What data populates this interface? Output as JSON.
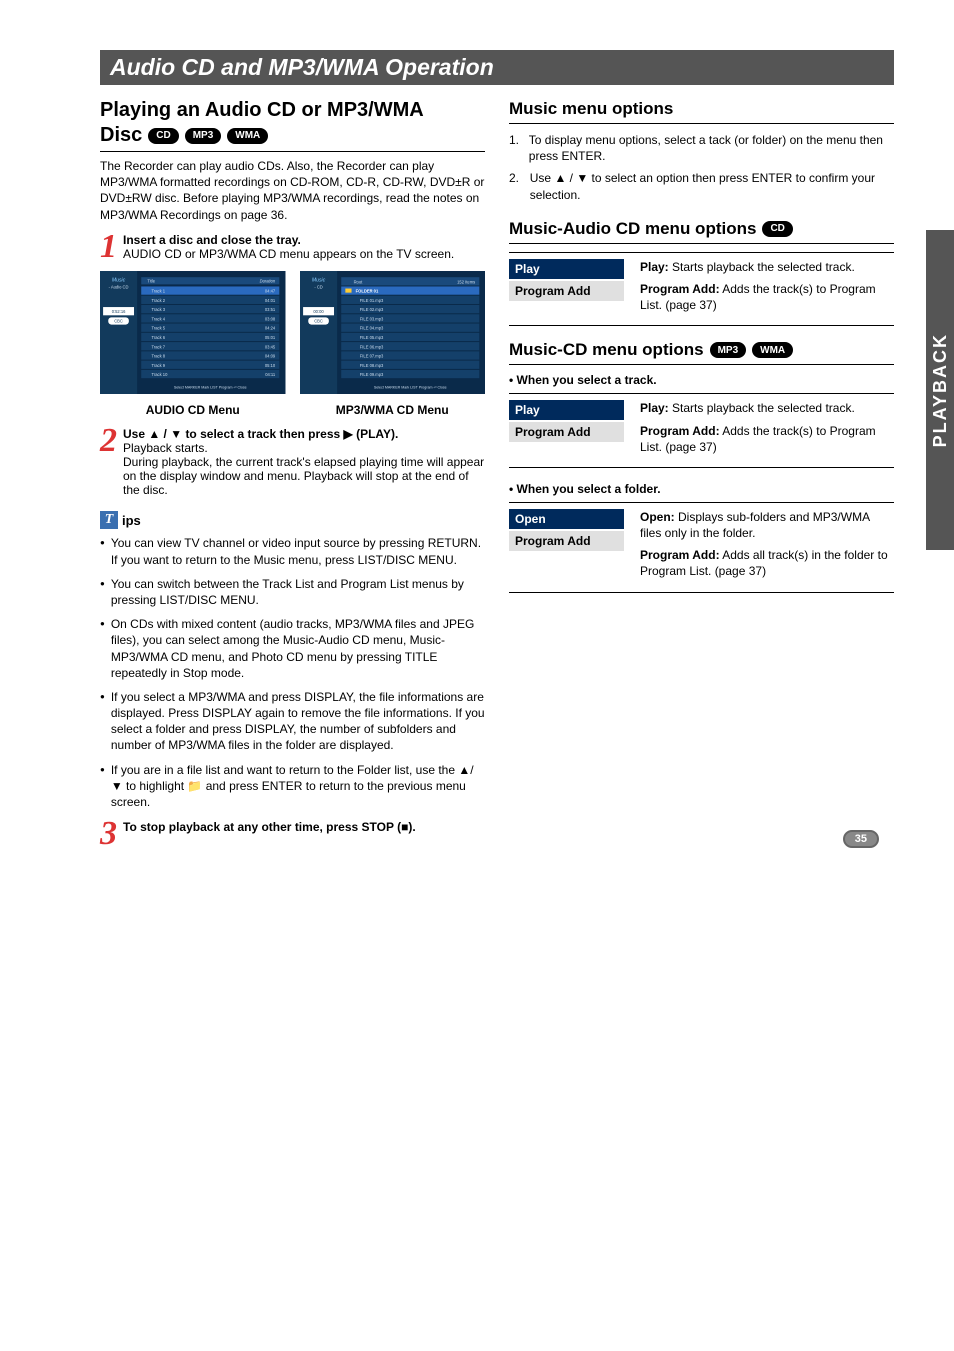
{
  "sidebar_tab": "PLAYBACK",
  "section_header": "Audio CD and MP3/WMA Operation",
  "left": {
    "title": "Playing an Audio CD or MP3/WMA",
    "disc_label": "Disc",
    "pills": [
      "CD",
      "MP3",
      "WMA"
    ],
    "intro": "The Recorder can play audio CDs. Also, the Recorder can play MP3/WMA formatted recordings on CD-ROM, CD-R, CD-RW, DVD±R or DVD±RW disc. Before playing MP3/WMA recordings, read the notes on MP3/WMA Recordings on page 36.",
    "step1_num": "1",
    "step1_bold": "Insert a disc and close the tray.",
    "step1_rest": "AUDIO CD or MP3/WMA CD menu appears on the TV screen.",
    "step2_num": "2",
    "step2_bold": "Use ▲ / ▼ to select a track then press ▶ (PLAY).",
    "step2_p1": "Playback starts.",
    "step2_p2": "During playback, the current track's elapsed playing time will appear on the display window and menu. Playback will stop at the end of the disc.",
    "step3_num": "3",
    "step3_bold": "To stop playback at any other time, press STOP (■).",
    "tips_label": "ips",
    "tips": [
      "You can view TV channel or video input source by pressing RETURN. If you want to return to the Music menu, press LIST/DISC MENU.",
      "You can switch between the Track List and Program List menus by pressing LIST/DISC MENU.",
      "On CDs with mixed content (audio tracks, MP3/WMA files and JPEG files), you can select among the Music-Audio CD menu, Music-MP3/WMA CD menu, and Photo CD menu by pressing TITLE repeatedly in Stop mode.",
      "If you select a MP3/WMA and press DISPLAY, the file informations are displayed. Press DISPLAY again to remove the file informations. If you select a folder and press DISPLAY, the number of subfolders and number of MP3/WMA files in the folder are displayed.",
      "If you are in a file list and want to return to the Folder list, use the ▲/▼ to highlight 📁 and press ENTER to return to the previous menu screen."
    ],
    "shot1": {
      "caption": "AUDIO CD Menu",
      "sidebar_title": "Music",
      "sidebar_sub": "- Audio CD",
      "status_time": "0:52:16",
      "status_badge": "CBC",
      "col_title": "Title",
      "col_duration": "Duration",
      "rows": [
        {
          "t": "Track 1",
          "d": "04:47"
        },
        {
          "t": "Track 2",
          "d": "04:01"
        },
        {
          "t": "Track 3",
          "d": "03:51"
        },
        {
          "t": "Track 4",
          "d": "03:08"
        },
        {
          "t": "Track 5",
          "d": "04:24"
        },
        {
          "t": "Track 6",
          "d": "05:01"
        },
        {
          "t": "Track 7",
          "d": "03:45"
        },
        {
          "t": "Track 8",
          "d": "04:09"
        },
        {
          "t": "Track 9",
          "d": "05:10"
        },
        {
          "t": "Track 10",
          "d": "04:11"
        }
      ],
      "footer": "Select  MARKER Mark  LIST Program  ⏎ Close"
    },
    "shot2": {
      "caption": "MP3/WMA CD Menu",
      "sidebar_title": "Music",
      "sidebar_sub": "- CD",
      "status_time": "00:00",
      "status_badge": "CBC",
      "root": "Root",
      "items_count": "152 Items",
      "folder": "FOLDER 01",
      "files": [
        "FILE 01.mp3",
        "FILE 02.mp3",
        "FILE 03.mp3",
        "FILE 04.mp3",
        "FILE 05.mp3",
        "FILE 06.mp3",
        "FILE 07.mp3",
        "FILE 08.mp3",
        "FILE 09.mp3"
      ],
      "footer": "Select  MARKER Mark  LIST Program  ⏎ Close"
    }
  },
  "right": {
    "h1": "Music menu options",
    "list": [
      "To display menu options, select a tack (or folder) on the menu then press ENTER.",
      "Use ▲ / ▼ to select an option then press ENTER to confirm your selection."
    ],
    "h2": "Music-Audio CD menu options",
    "h2_pill": "CD",
    "block1": {
      "items": [
        "Play",
        "Program Add"
      ],
      "descs": [
        {
          "b": "Play:",
          "t": " Starts playback the selected track."
        },
        {
          "b": "Program Add:",
          "t": " Adds the track(s) to Program List. (page 37)"
        }
      ]
    },
    "h3": "Music-CD menu options",
    "h3_pills": [
      "MP3",
      "WMA"
    ],
    "sub_track": "•  When you select a track.",
    "block2": {
      "items": [
        "Play",
        "Program Add"
      ],
      "descs": [
        {
          "b": "Play:",
          "t": " Starts playback the selected track."
        },
        {
          "b": "Program Add:",
          "t": " Adds the track(s) to Program List. (page 37)"
        }
      ]
    },
    "sub_folder": "•  When you select a folder.",
    "block3": {
      "items": [
        "Open",
        "Program Add"
      ],
      "descs": [
        {
          "b": "Open:",
          "t": " Displays sub-folders and MP3/WMA files only in the folder."
        },
        {
          "b": "Program Add:",
          "t": " Adds all track(s) in the folder to Program List. (page 37)"
        }
      ]
    }
  },
  "page_number": "35"
}
